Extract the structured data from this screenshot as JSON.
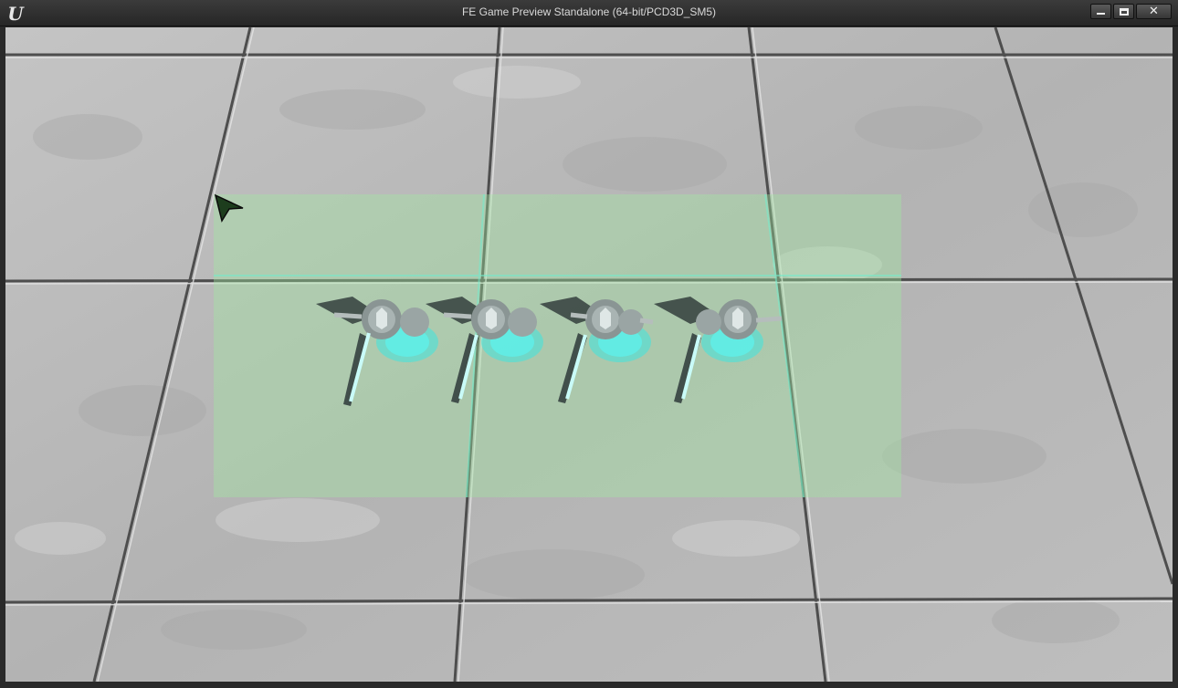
{
  "window": {
    "title": "FE Game Preview Standalone (64-bit/PCD3D_SM5)",
    "logo_icon": "unreal-engine-logo",
    "controls": {
      "minimize_icon": "minimize-icon",
      "maximize_icon": "maximize-icon",
      "close_icon": "close-icon",
      "close_glyph": "✕"
    }
  },
  "scene": {
    "floor_colors": {
      "tile": "#b8b8b8",
      "tile_light": "#c6c6c6",
      "grout": "#5a5a5a"
    },
    "selection_box_color": "#a0eba0",
    "highlight_color": "#3ee6e0",
    "cursor_icon": "arrow-cursor-icon",
    "units": [
      {
        "name": "soldier-unit-1",
        "icon": "armored-soldier-icon"
      },
      {
        "name": "soldier-unit-2",
        "icon": "armored-soldier-icon"
      },
      {
        "name": "soldier-unit-3",
        "icon": "armored-soldier-icon"
      },
      {
        "name": "soldier-unit-4",
        "icon": "armored-soldier-icon"
      }
    ]
  }
}
